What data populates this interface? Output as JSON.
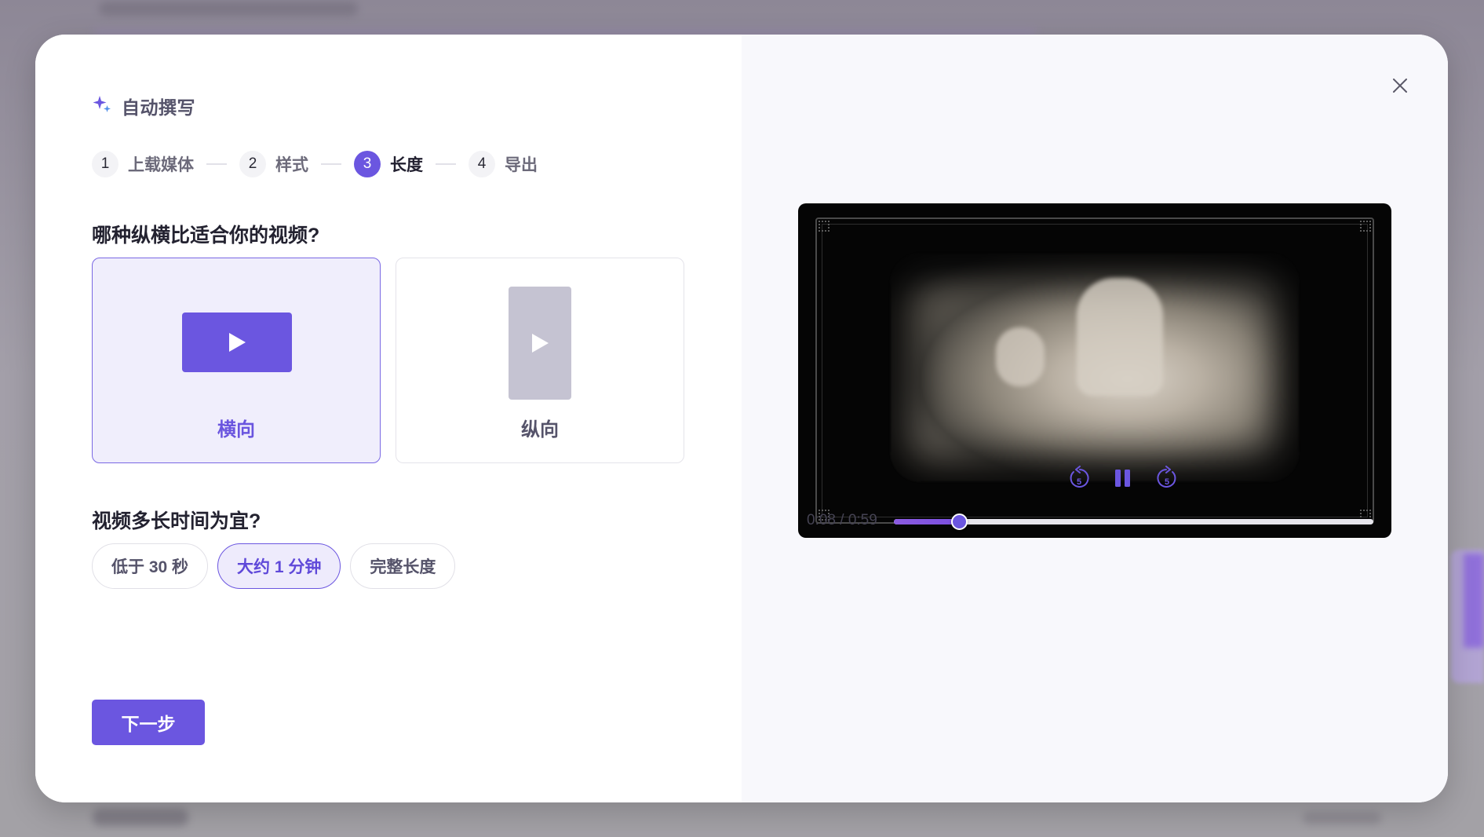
{
  "dialog": {
    "title": "自动撰写",
    "steps": [
      {
        "num": "1",
        "label": "上载媒体"
      },
      {
        "num": "2",
        "label": "样式"
      },
      {
        "num": "3",
        "label": "长度"
      },
      {
        "num": "4",
        "label": "导出"
      }
    ],
    "active_step": 3,
    "aspect_question": "哪种纵横比适合你的视频?",
    "aspect_options": [
      {
        "label": "横向",
        "selected": true
      },
      {
        "label": "纵向",
        "selected": false
      }
    ],
    "length_question": "视频多长时间为宜?",
    "length_options": [
      {
        "label": "低于 30 秒",
        "selected": false
      },
      {
        "label": "大约 1 分钟",
        "selected": true
      },
      {
        "label": "完整长度",
        "selected": false
      }
    ],
    "next_label": "下一步"
  },
  "player": {
    "time_display": "0:08 / 0:59",
    "progress_fraction": 0.1356,
    "rewind_seconds": "5",
    "forward_seconds": "5",
    "state": "playing"
  },
  "colors": {
    "accent": "#6b56e0",
    "accent_light": "#f0eefc"
  },
  "icons": {
    "title": "sparkle-icon",
    "close": "close-icon",
    "rewind": "rewind-5-icon",
    "pause": "pause-icon",
    "forward": "forward-5-icon",
    "play": "play-icon"
  }
}
